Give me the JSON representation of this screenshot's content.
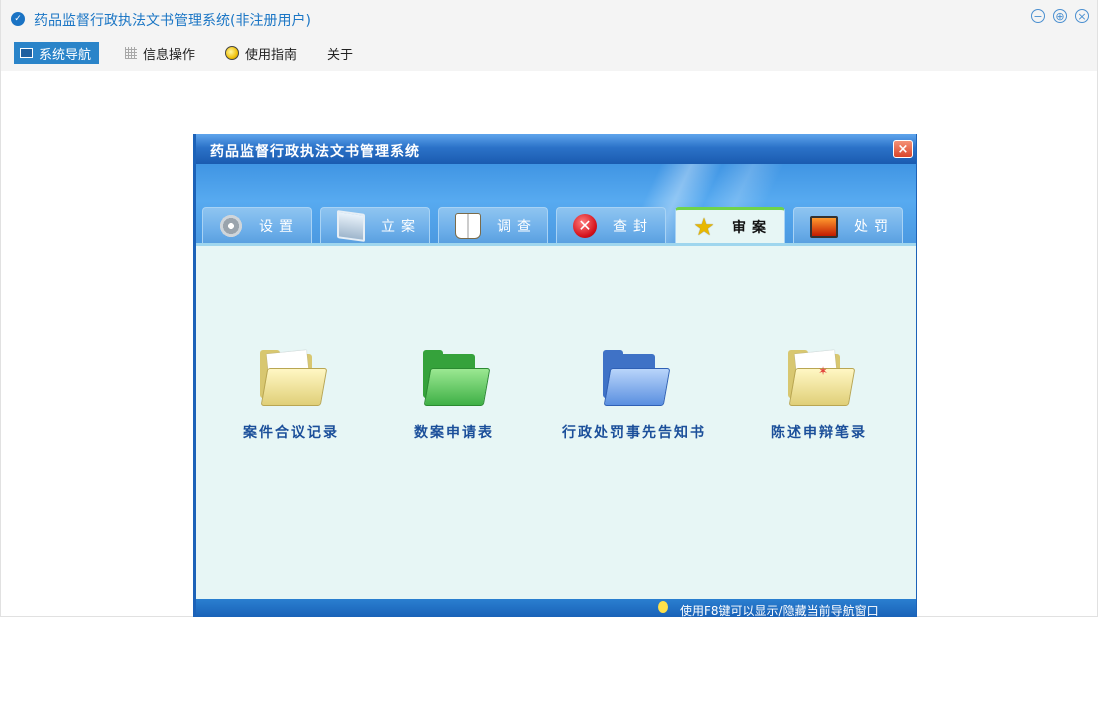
{
  "app": {
    "title": "药品监督行政执法文书管理系统(非注册用户)",
    "window_buttons": {
      "minimize": "−",
      "restore": "⊕",
      "close": "×"
    }
  },
  "menu": [
    {
      "label": "系统导航",
      "icon": "monitor-icon",
      "active": true
    },
    {
      "label": "信息操作",
      "icon": "grid-icon",
      "active": false
    },
    {
      "label": "使用指南",
      "icon": "guide-icon",
      "active": false
    },
    {
      "label": "关于",
      "icon": "",
      "active": false
    }
  ],
  "nav_window": {
    "title": "药品监督行政执法文书管理系统",
    "close": "×",
    "tabs": [
      {
        "label": "设置",
        "icon": "gear-icon"
      },
      {
        "label": "立案",
        "icon": "monitor-icon"
      },
      {
        "label": "调查",
        "icon": "book-icon"
      },
      {
        "label": "查封",
        "icon": "red-x-icon"
      },
      {
        "label": "审案",
        "icon": "star-icon",
        "active": true
      },
      {
        "label": "处罚",
        "icon": "screen-icon"
      }
    ],
    "items": [
      {
        "label": "案件合议记录",
        "icon": "yellow-folder-icon"
      },
      {
        "label": "数案申请表",
        "icon": "green-folder-icon"
      },
      {
        "label": "行政处罚事先告知书",
        "icon": "blue-folder-icon"
      },
      {
        "label": "陈述申辩笔录",
        "icon": "yellow-folder-icon"
      }
    ],
    "status": "使用F8键可以显示/隐藏当前导航窗口"
  }
}
